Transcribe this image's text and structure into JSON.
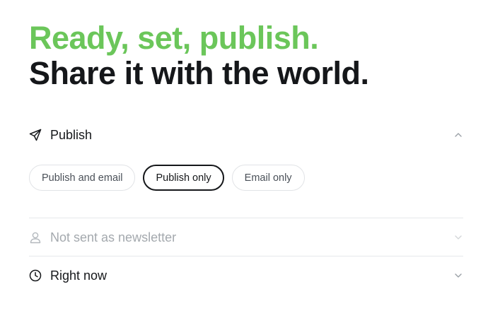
{
  "headline": {
    "accent": "Ready, set, publish.",
    "main": "Share it with the world."
  },
  "publish_section": {
    "label": "Publish",
    "icon": "paper-plane-icon",
    "expanded": true,
    "options": [
      {
        "label": "Publish and email",
        "selected": false
      },
      {
        "label": "Publish only",
        "selected": true
      },
      {
        "label": "Email only",
        "selected": false
      }
    ]
  },
  "newsletter_section": {
    "label": "Not sent as newsletter",
    "icon": "user-icon",
    "disabled": true
  },
  "schedule_section": {
    "label": "Right now",
    "icon": "clock-icon"
  },
  "colors": {
    "accent": "#6bc65a",
    "text": "#15171a",
    "muted": "#a4a9ae",
    "border": "#e1e3e6"
  }
}
